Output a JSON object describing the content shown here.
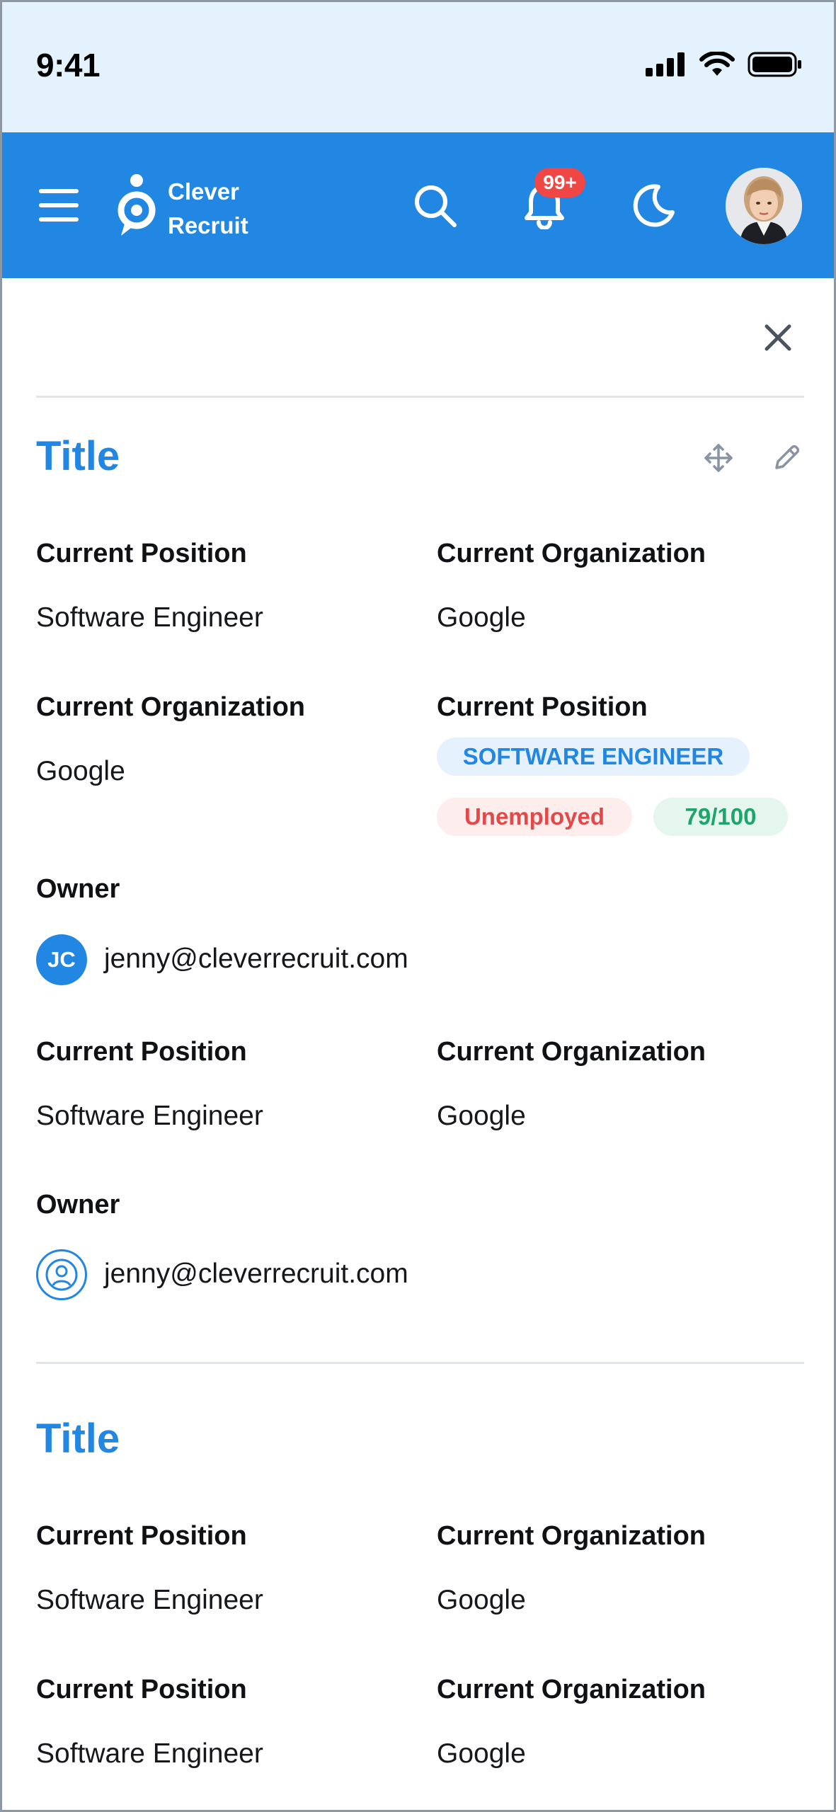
{
  "status_bar": {
    "time": "9:41"
  },
  "header": {
    "logo_line1": "Clever",
    "logo_line2": "Recruit",
    "notification_count": "99+",
    "brand_color": "#2187e3",
    "icons": [
      "menu-icon",
      "search-icon",
      "bell-icon",
      "moon-icon"
    ]
  },
  "sections": [
    {
      "title": "Title",
      "fields": {
        "row1_left_label": "Current Position",
        "row1_left_value": "Software Engineer",
        "row1_right_label": "Current Organization",
        "row1_right_value": "Google",
        "row2_left_label": "Current Organization",
        "row2_left_value": "Google",
        "row2_right_label": "Current Position",
        "tag_position": "SOFTWARE ENGINEER",
        "tag_status": "Unemployed",
        "tag_score": "79/100",
        "owner1_label": "Owner",
        "owner1_initials": "JC",
        "owner1_email": "jenny@cleverrecruit.com",
        "row3_left_label": "Current Position",
        "row3_left_value": "Software Engineer",
        "row3_right_label": "Current Organization",
        "row3_right_value": "Google",
        "owner2_label": "Owner",
        "owner2_email": "jenny@cleverrecruit.com"
      }
    },
    {
      "title": "Title",
      "fields": {
        "row1_left_label": "Current Position",
        "row1_left_value": "Software Engineer",
        "row1_right_label": "Current Organization",
        "row1_right_value": "Google",
        "row2_left_label": "Current Position",
        "row2_left_value": "Software Engineer",
        "row2_right_label": "Current Organization",
        "row2_right_value": "Google"
      }
    }
  ],
  "colors": {
    "status_bar_bg": "#e3f2fd",
    "tag_blue": "#2187e3",
    "tag_red": "#e24a4a",
    "tag_green": "#1fa56c",
    "badge_red": "#f04646"
  }
}
